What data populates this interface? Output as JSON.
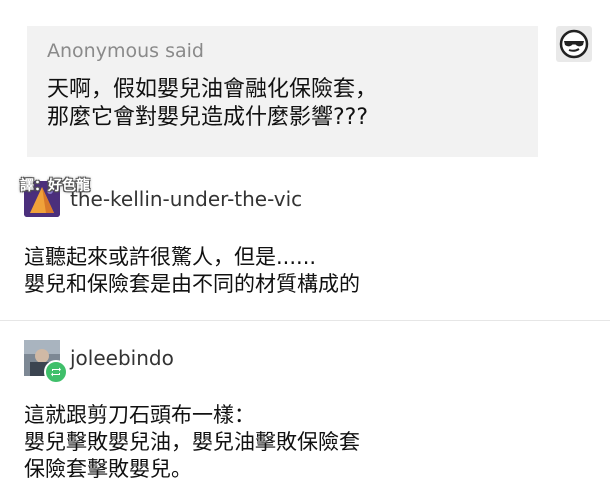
{
  "ask": {
    "asker_name": "Anonymous",
    "said_label": "said",
    "lines": [
      "天啊，假如嬰兒油會融化保險套，",
      "那麼它會對嬰兒造成什麼影響???"
    ],
    "avatar_icon": "anonymous-sunglasses-icon"
  },
  "translator_note": "譯：好色龍",
  "reply1": {
    "username": "the-kellin-under-the-vic",
    "avatar_icon": "user-avatar-triangle",
    "lines": [
      "這聽起來或許很驚人，但是......",
      "嬰兒和保險套是由不同的材質構成的"
    ]
  },
  "reply2": {
    "username": "joleebindo",
    "avatar_icon": "user-avatar-photo",
    "reblog_icon": "reblog-icon",
    "lines": [
      "這就跟剪刀石頭布一樣：",
      "嬰兒擊敗嬰兒油，嬰兒油擊敗保險套",
      "保險套擊敗嬰兒。"
    ]
  },
  "colors": {
    "ask_background": "#f2f2f2",
    "reblog_badge": "#3fbf6a",
    "muted_text": "#8a8a8a"
  }
}
